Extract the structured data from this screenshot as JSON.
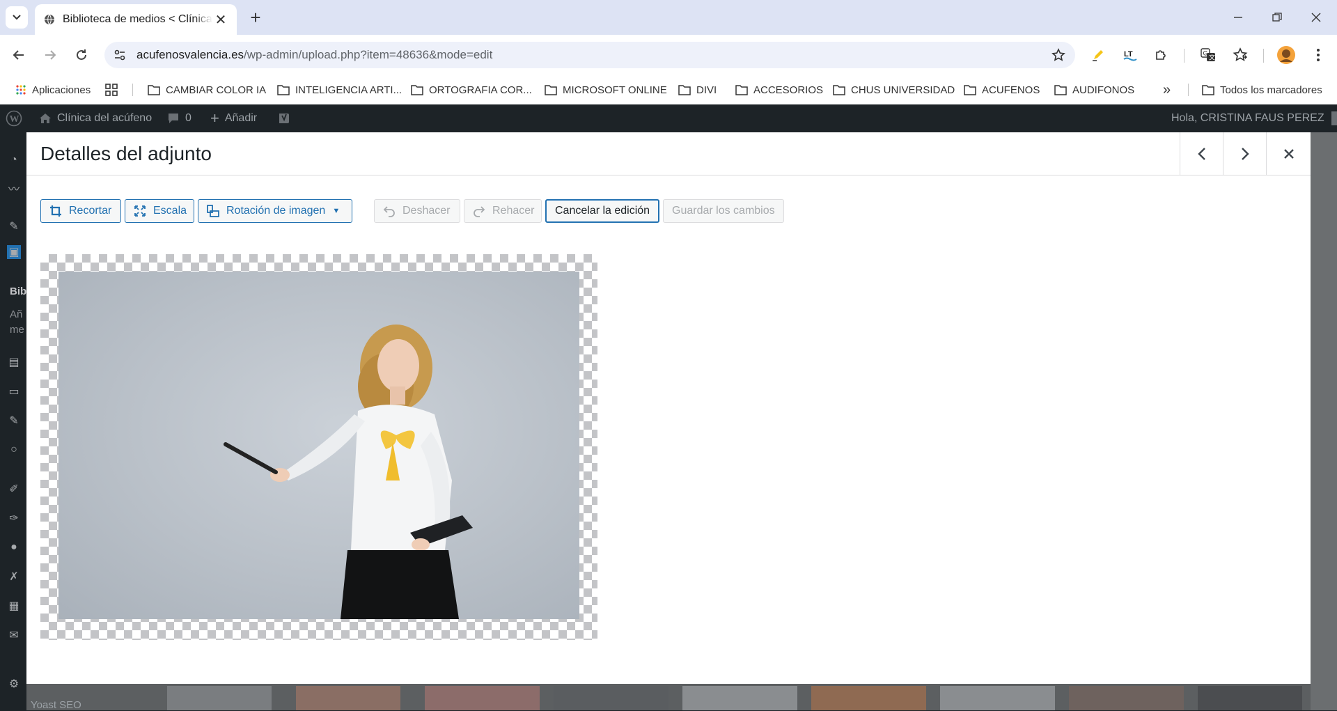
{
  "browser": {
    "tab_title": "Biblioteca de medios < Clínica del acúfeno",
    "url_host": "acufenosvalencia.es",
    "url_path": "/wp-admin/upload.php?item=48636&mode=edit"
  },
  "bookmarks": {
    "apps": "Aplicaciones",
    "items": [
      {
        "label": "CAMBIAR COLOR IA"
      },
      {
        "label": "INTELIGENCIA ARTI..."
      },
      {
        "label": "ORTOGRAFIA COR..."
      },
      {
        "label": "MICROSOFT ONLINE"
      },
      {
        "label": "DIVI"
      },
      {
        "label": "ACCESORIOS"
      },
      {
        "label": "CHUS UNIVERSIDAD"
      },
      {
        "label": "ACUFENOS"
      },
      {
        "label": "AUDIFONOS"
      }
    ],
    "overflow": "»",
    "all": "Todos los marcadores"
  },
  "adminbar": {
    "site_name": "Clínica del acúfeno",
    "comments_count": "0",
    "add_new": "Añadir",
    "greeting": "Hola, CRISTINA FAUS PEREZ"
  },
  "sidebar_partial": {
    "label1": "Bib",
    "label2": "Añ",
    "label3": "me",
    "yoast": "Yoast SEO"
  },
  "modal": {
    "title": "Detalles del adjunto",
    "toolbar": {
      "crop": "Recortar",
      "scale": "Escala",
      "rotate": "Rotación de imagen",
      "undo": "Deshacer",
      "redo": "Rehacer",
      "cancel": "Cancelar la edición",
      "save": "Guardar los cambios"
    }
  },
  "colors": {
    "wp_blue": "#2271b1",
    "admin_bar": "#1d2327",
    "browser_tabstrip": "#dde3f4"
  }
}
